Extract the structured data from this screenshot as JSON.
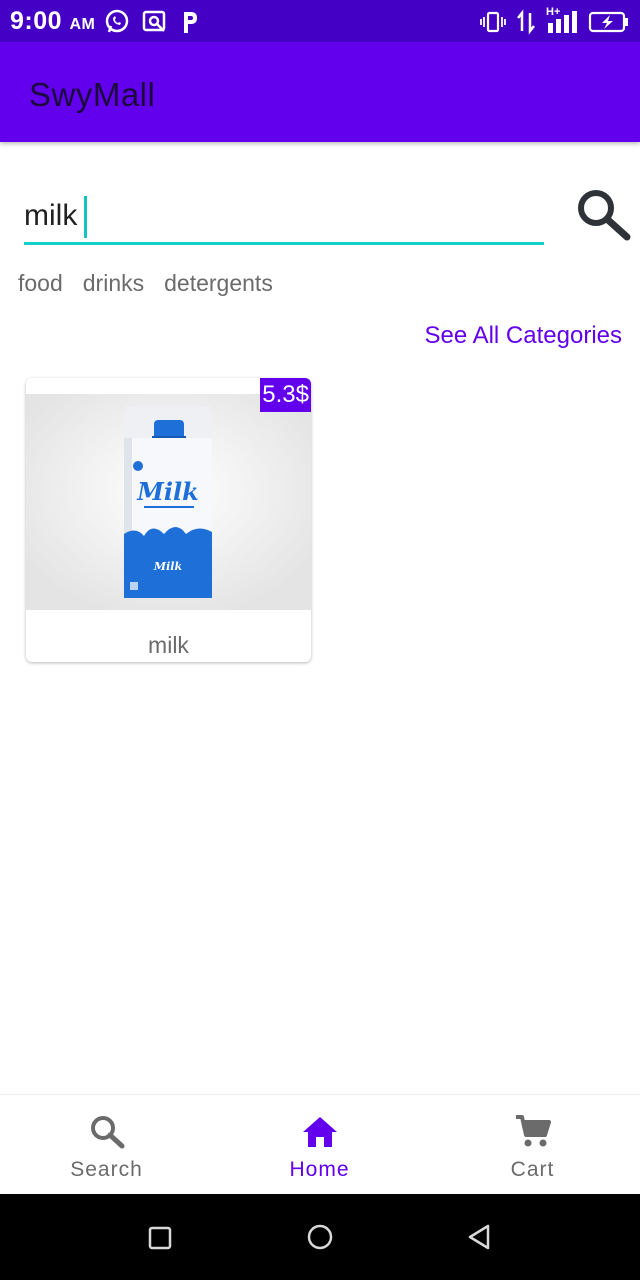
{
  "status_bar": {
    "time": "9:00",
    "ampm": "AM",
    "network": "H+",
    "icons": [
      "whatsapp-icon",
      "lens-icon",
      "paypal-icon",
      "vibrate-icon",
      "data-arrows-icon",
      "signal-icon",
      "battery-charging-icon"
    ]
  },
  "app": {
    "title": "SwyMall"
  },
  "search": {
    "value": "milk",
    "icon": "search-icon"
  },
  "categories": [
    "food",
    "drinks",
    "detergents"
  ],
  "see_all_label": "See All Categories",
  "products": [
    {
      "name": "milk",
      "price": "5.3$",
      "image": "milk-carton"
    }
  ],
  "bottom_nav": {
    "items": [
      {
        "label": "Search",
        "icon": "search-icon",
        "active": false
      },
      {
        "label": "Home",
        "icon": "home-icon",
        "active": true
      },
      {
        "label": "Cart",
        "icon": "cart-icon",
        "active": false
      }
    ],
    "active_color": "#6200ee",
    "inactive_color": "#6b6b6b"
  },
  "system_nav": [
    "recents-square-icon",
    "home-circle-icon",
    "back-triangle-icon"
  ],
  "colors": {
    "status_bar": "#4400c4",
    "app_bar": "#6200ee",
    "accent": "#13cfc9"
  }
}
